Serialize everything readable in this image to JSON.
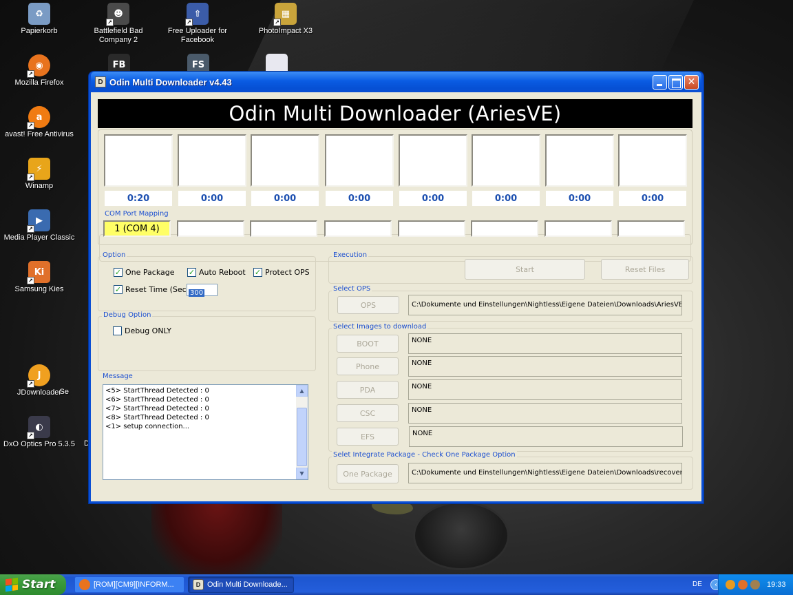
{
  "desktop": {
    "icons": [
      {
        "label": "Papierkorb",
        "icon": "recycle-bin-icon",
        "color": "#7a9bc4"
      },
      {
        "label": "Battlefield Bad\nCompany 2",
        "icon": "battlefield-icon",
        "color": "#4a4a4a"
      },
      {
        "label": "Free Uploader for\nFacebook",
        "icon": "uploader-icon",
        "color": "#3b5ca8"
      },
      {
        "label": "PhotoImpact X3",
        "icon": "photoimpact-icon",
        "color": "#c9a43b"
      },
      {
        "label": "Mozilla Firefox",
        "icon": "firefox-icon",
        "color": "#e8731e"
      },
      {
        "label": "avast! Free Antivirus",
        "icon": "avast-icon",
        "color": "#f07b12"
      },
      {
        "label": "Winamp",
        "icon": "winamp-icon",
        "color": "#e8a51a"
      },
      {
        "label": "Media Player Classic",
        "icon": "media-player-icon",
        "color": "#3a6bb0"
      },
      {
        "label": "Samsung Kies",
        "icon": "kies-icon",
        "color": "#e0702a"
      },
      {
        "label": "JDownloader",
        "icon": "jdownloader-icon",
        "color": "#f0a020"
      },
      {
        "label": "DxO Optics Pro 5.3.5",
        "icon": "dxo-icon",
        "color": "#3a3a4a"
      }
    ],
    "partial_icons": [
      {
        "label": "Se"
      },
      {
        "label": "D"
      }
    ],
    "partial_icon_glyphs": {
      "fb": "FB",
      "fs": "FS"
    }
  },
  "window": {
    "app_icon_text": "D",
    "title": "Odin Multi Downloader v4.43",
    "close_glyph": "✕",
    "banner": "Odin Multi Downloader (AriesVE)",
    "times": [
      "0:20",
      "0:00",
      "0:00",
      "0:00",
      "0:00",
      "0:00",
      "0:00",
      "0:00"
    ],
    "com_port_label": "COM Port Mapping",
    "com_ports": [
      "1 (COM 4)",
      "",
      "",
      "",
      "",
      "",
      "",
      ""
    ],
    "option": {
      "label": "Option",
      "one_package": "One Package",
      "auto_reboot": "Auto Reboot",
      "protect_ops": "Protect OPS",
      "reset_time": "Reset Time (Sec)",
      "reset_time_value": "300",
      "check_glyph": "✓"
    },
    "debug": {
      "label": "Debug Option",
      "debug_only": "Debug ONLY"
    },
    "message": {
      "label": "Message",
      "lines": [
        "<5> StartThread Detected : 0",
        "<6> StartThread Detected : 0",
        "<7> StartThread Detected : 0",
        "<8> StartThread Detected : 0",
        "<1> setup connection..."
      ],
      "up_arrow": "▲",
      "down_arrow": "▼"
    },
    "execution": {
      "label": "Execution",
      "start": "Start",
      "reset_files": "Reset Files"
    },
    "select_ops": {
      "label": "Select OPS",
      "button": "OPS",
      "path": "C:\\Dokumente und Einstellungen\\Nightless\\Eigene Dateien\\Downloads\\AriesVE.ops"
    },
    "images": {
      "label": "Select Images to download",
      "rows": [
        {
          "button": "BOOT",
          "value": "NONE"
        },
        {
          "button": "Phone",
          "value": "NONE"
        },
        {
          "button": "PDA",
          "value": "NONE"
        },
        {
          "button": "CSC",
          "value": "NONE"
        },
        {
          "button": "EFS",
          "value": "NONE"
        }
      ]
    },
    "integrate": {
      "label": "Selet Integrate Package - Check One Package Option",
      "button": "One Package",
      "path": "C:\\Dokumente und Einstellungen\\Nightless\\Eigene Dateien\\Downloads\\recovery-"
    }
  },
  "taskbar": {
    "start": "Start",
    "tasks": [
      {
        "label": "[ROM][CM9][INFORM...",
        "icon": "firefox-icon"
      },
      {
        "label": "Odin Multi Downloade...",
        "icon": "odin-icon",
        "icon_text": "D"
      }
    ],
    "language": "DE",
    "tray_arrow": "‹",
    "clock": "19:33"
  },
  "colors": {
    "window_blue": "#0a4fd4",
    "label_blue": "#1c4fd0",
    "time_blue": "#1c4fb0",
    "com_active": "#ffff66",
    "check_green": "#21a121"
  }
}
